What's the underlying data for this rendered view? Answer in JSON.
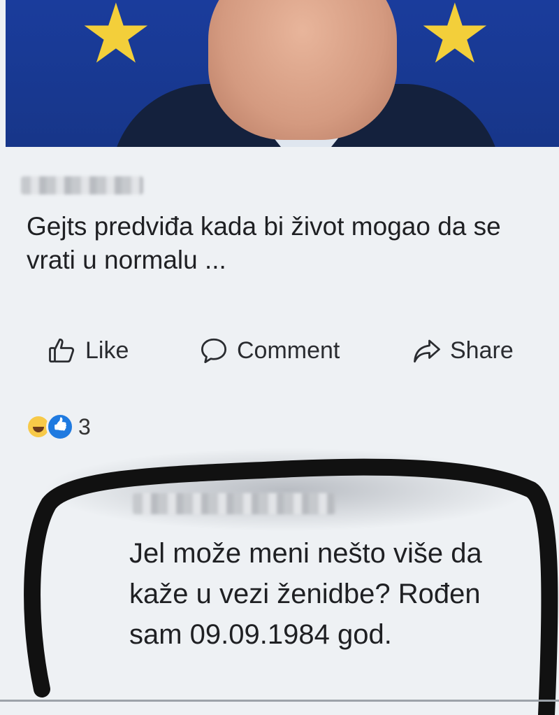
{
  "post": {
    "headline": "Gejts predviđa kada bi život mogao da se vrati u normalu ..."
  },
  "actions": {
    "like_label": "Like",
    "comment_label": "Comment",
    "share_label": "Share"
  },
  "reactions": {
    "count": "3",
    "types": [
      "haha-icon",
      "like-icon"
    ]
  },
  "comment": {
    "text": "Jel može meni nešto više da kaže u vezi ženidbe?  Rođen sam 09.09.1984 god."
  },
  "colors": {
    "background": "#eef1f4",
    "flag_blue": "#1a3c9c",
    "star_yellow": "#f3cf3a",
    "marker": "#111111"
  }
}
